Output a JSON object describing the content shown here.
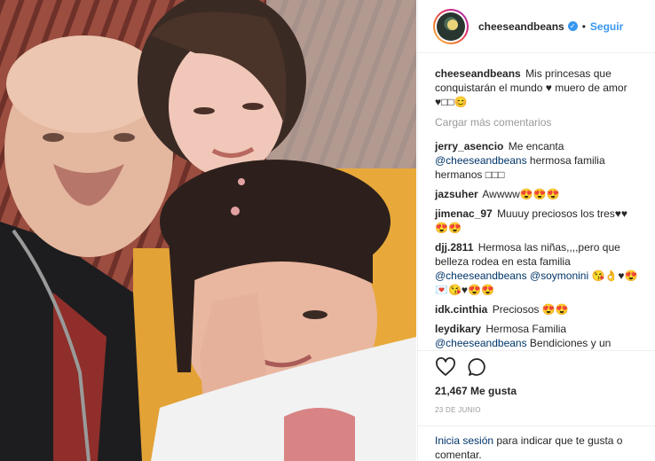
{
  "header": {
    "username": "cheeseandbeans",
    "verified_icon": "verified-badge-icon",
    "separator": "•",
    "follow_label": "Seguir"
  },
  "caption": {
    "username": "cheeseandbeans",
    "text": "Mis princesas que conquistarán el mundo ♥ muero de amor ♥□□😊"
  },
  "load_more": "Cargar más comentarios",
  "comments": [
    {
      "username": "jerry_asencio",
      "pre": "Me encanta ",
      "mention": "@cheeseandbeans",
      "post": " hermosa familia hermanos □□□"
    },
    {
      "username": "jazsuher",
      "pre": "Awwww😍😍😍",
      "mention": "",
      "post": ""
    },
    {
      "username": "jimenac_97",
      "pre": "Muuuy preciosos los tres♥♥😍😍",
      "mention": "",
      "post": ""
    },
    {
      "username": "djj.2811",
      "pre": "Hermosa las niñas,,,,pero que belleza rodea en esta familia ",
      "mention": "@cheeseandbeans @soymonini",
      "post": " 😘👌♥😍💌😘♥😍😍"
    },
    {
      "username": "idk.cinthia",
      "pre": "Preciosos 😍😍",
      "mention": "",
      "post": ""
    },
    {
      "username": "leydikary",
      "pre": "Hermosa Familia ",
      "mention": "@cheeseandbeans",
      "post": " Bendiciones y un abrazo desde méxico 🇲🇽 😊"
    }
  ],
  "actions": {
    "like_icon": "heart-icon",
    "comment_icon": "comment-bubble-icon",
    "likes": "21,467 Me gusta",
    "date": "23 DE JUNIO"
  },
  "login": {
    "link": "Inicia sesión",
    "text": " para indicar que te gusta o comentar."
  },
  "colors": {
    "link_blue": "#3897f0",
    "mention_blue": "#003569",
    "muted": "#999999",
    "border": "#efefef"
  }
}
